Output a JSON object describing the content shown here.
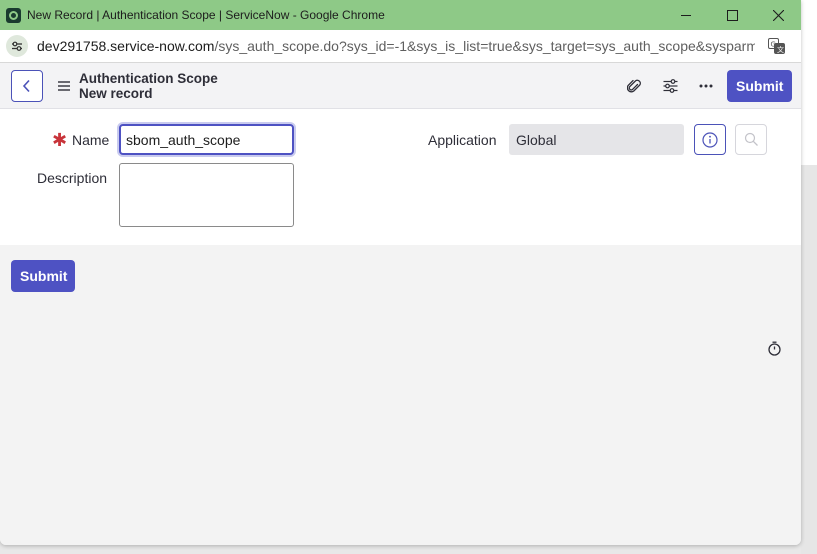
{
  "browser": {
    "window_title": "New Record | Authentication Scope | ServiceNow - Google Chrome",
    "url_domain": "dev291758.service-now.com",
    "url_path": "/sys_auth_scope.do?sys_id=-1&sys_is_list=true&sys_target=sys_auth_scope&sysparm_..."
  },
  "header": {
    "title": "Authentication Scope",
    "subtitle": "New record",
    "submit_label": "Submit"
  },
  "form": {
    "name_label": "Name",
    "name_value": "sbom_auth_scope",
    "description_label": "Description",
    "description_value": "",
    "application_label": "Application",
    "application_value": "Global"
  },
  "footer": {
    "submit_label": "Submit"
  },
  "colors": {
    "titlebar": "#8ec987",
    "primary": "#4e52c3",
    "required": "#c8343a"
  },
  "icons": {
    "back": "chevron-left-icon",
    "menu": "hamburger-icon",
    "attach": "paperclip-icon",
    "settings": "sliders-icon",
    "more": "ellipsis-icon",
    "info": "info-icon",
    "lookup": "search-icon",
    "timer": "stopwatch-icon"
  }
}
